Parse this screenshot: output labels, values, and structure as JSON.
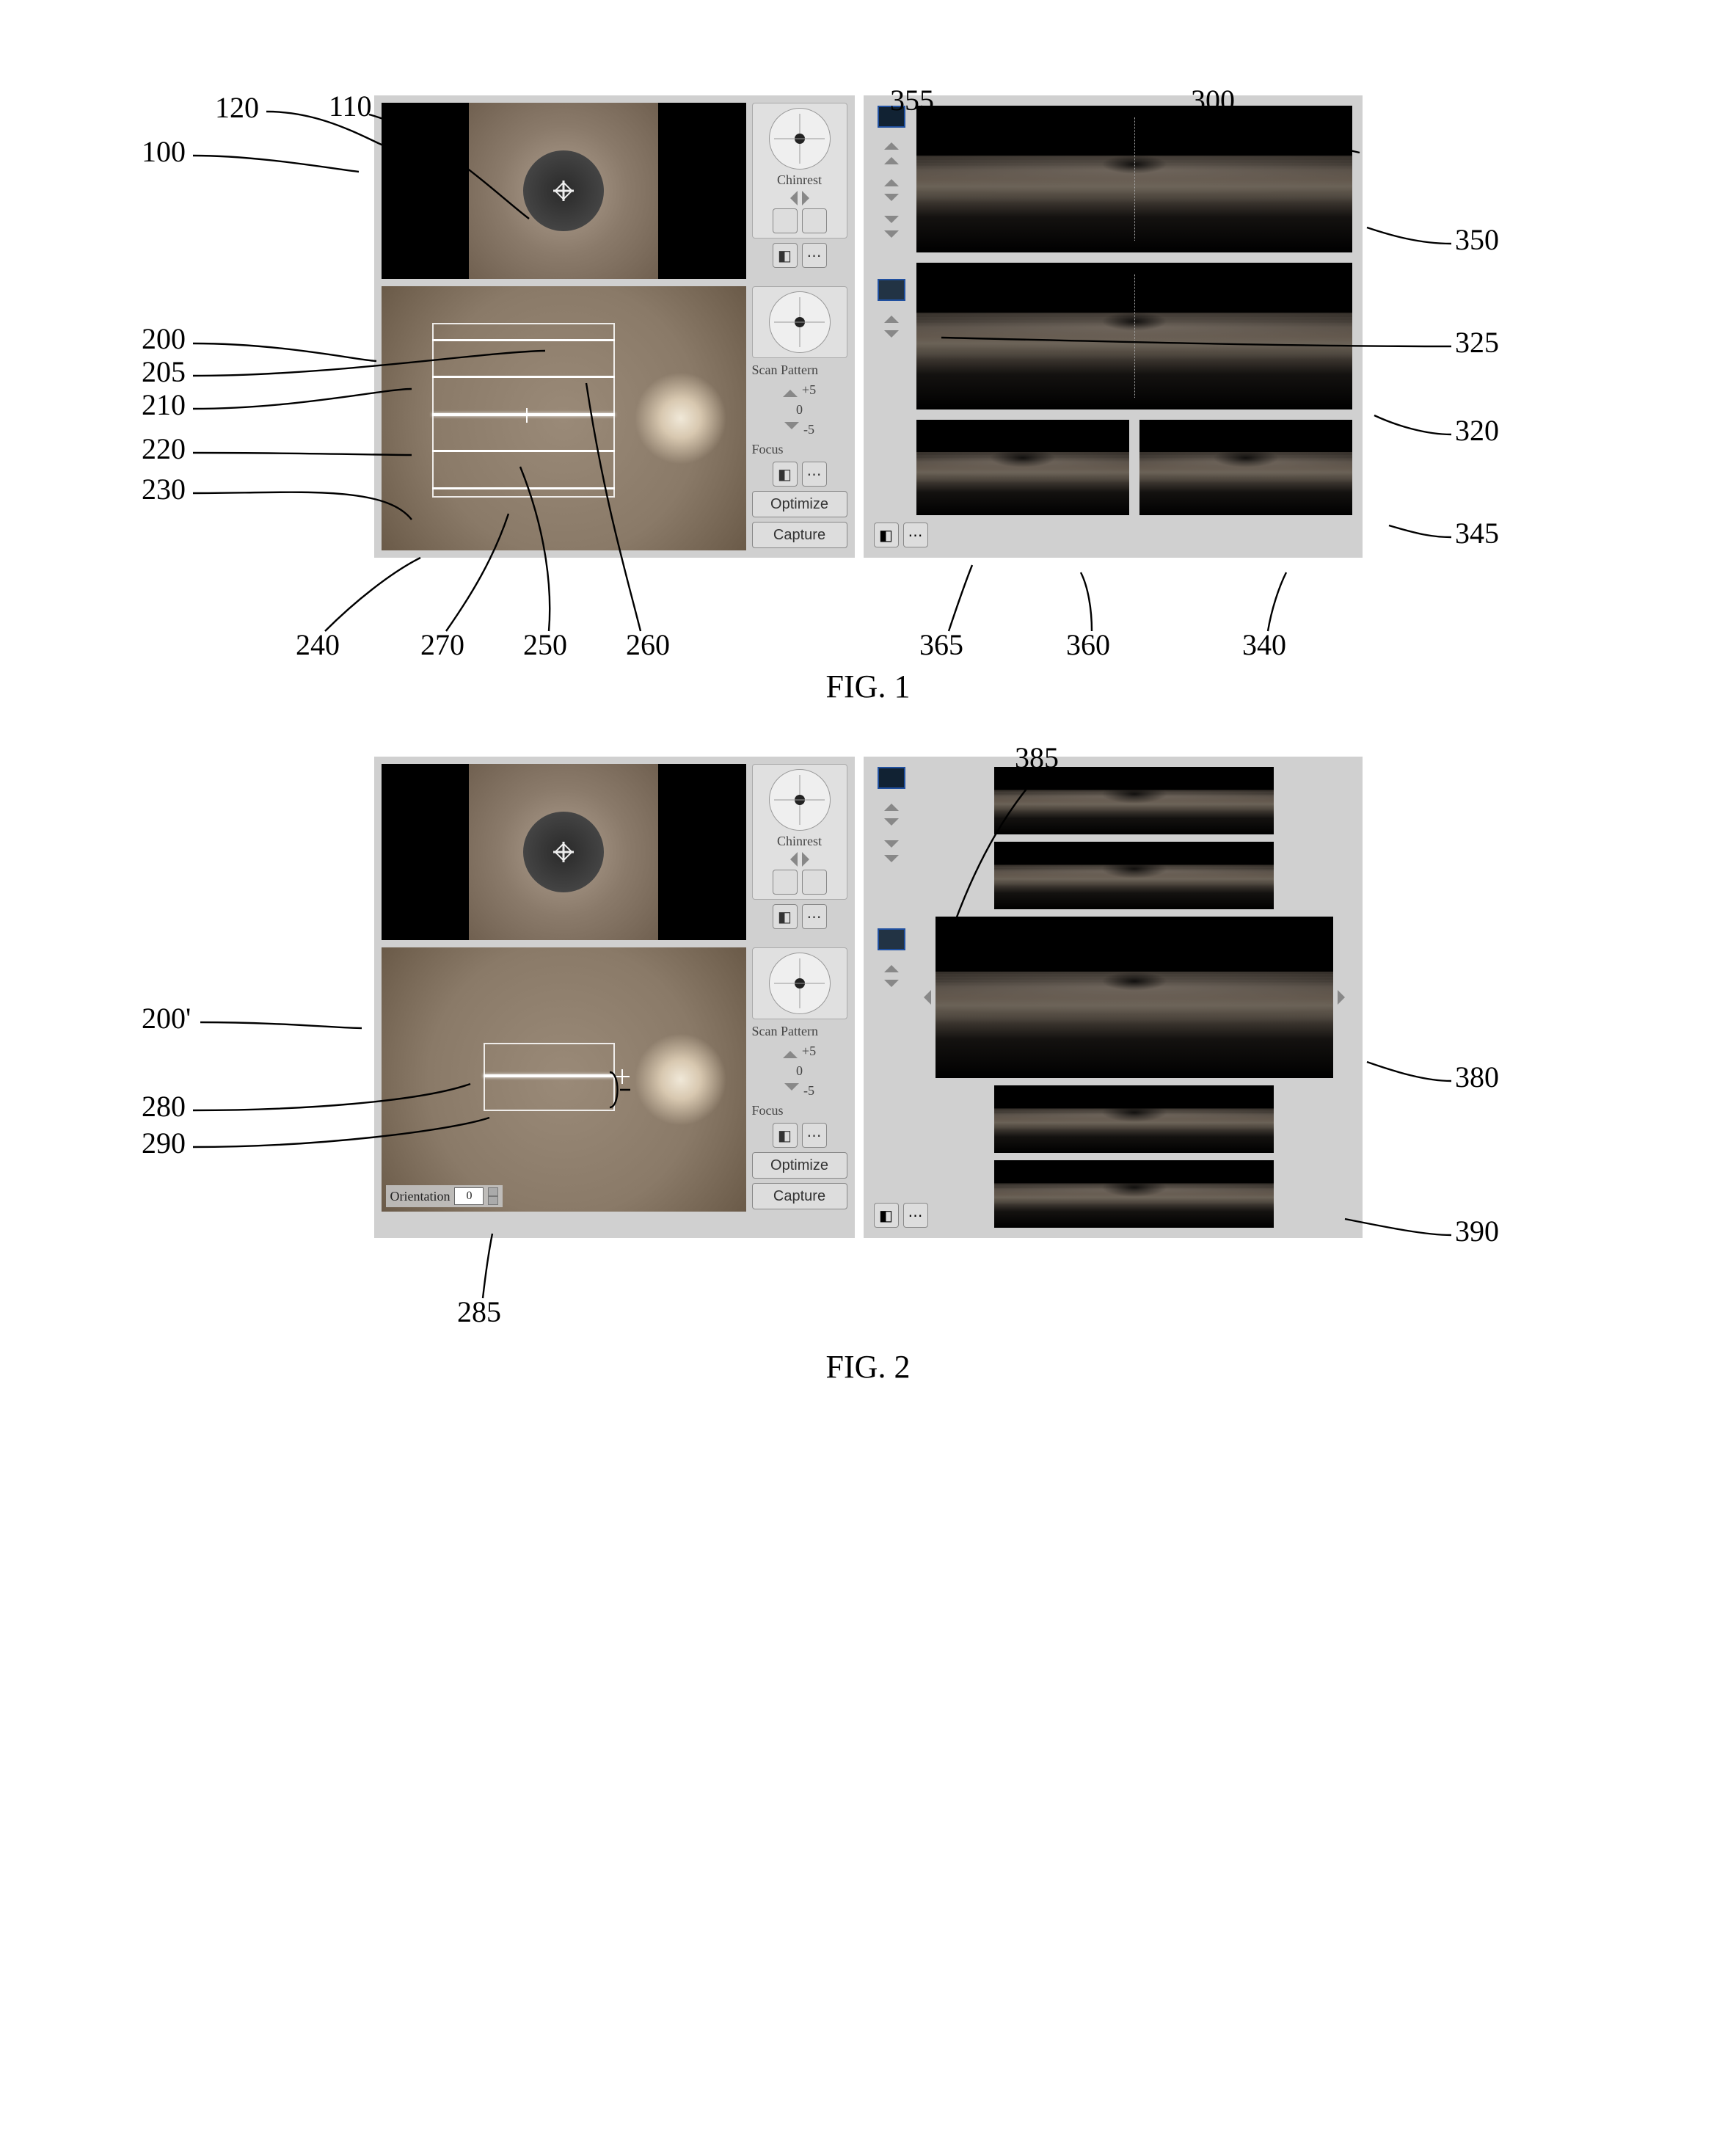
{
  "figures": {
    "fig1": {
      "caption": "FIG. 1"
    },
    "fig2": {
      "caption": "FIG. 2"
    }
  },
  "controls": {
    "chinrest_label": "Chinrest",
    "scan_pattern_label": "Scan Pattern",
    "focus_label": "Focus",
    "optimize_label": "Optimize",
    "capture_label": "Capture",
    "step_plus5": "+5",
    "step_0": "0",
    "step_minus5": "-5",
    "orientation_label": "Orientation",
    "orientation_value": "0"
  },
  "callouts": {
    "fig1": {
      "100": "100",
      "110": "110",
      "120": "120",
      "200": "200",
      "205": "205",
      "210": "210",
      "220": "220",
      "230": "230",
      "240": "240",
      "270": "270",
      "250": "250",
      "260": "260",
      "300": "300",
      "355": "355",
      "350": "350",
      "325": "325",
      "320": "320",
      "345": "345",
      "365": "365",
      "360": "360",
      "340": "340"
    },
    "fig2": {
      "200p": "200'",
      "280": "280",
      "290": "290",
      "285": "285",
      "385": "385",
      "380": "380",
      "390": "390"
    }
  }
}
